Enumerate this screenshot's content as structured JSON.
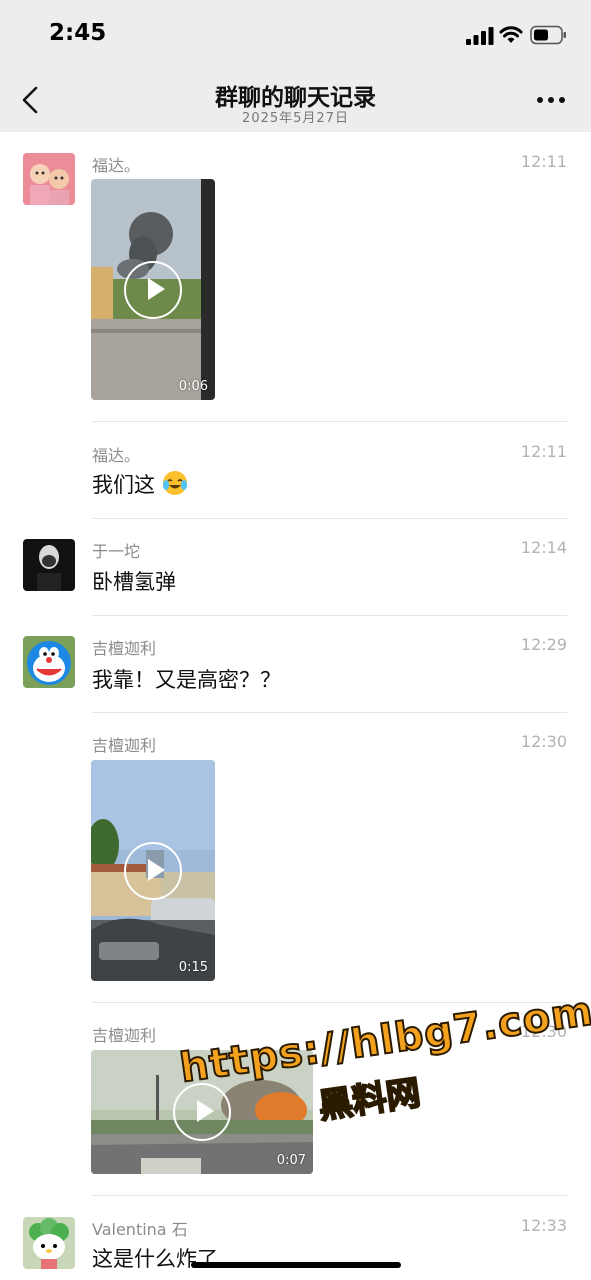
{
  "status_bar": {
    "time": "2:45"
  },
  "nav": {
    "title": "群聊的聊天记录",
    "subtitle": "2025年5月27日"
  },
  "messages": [
    {
      "sender": "福达。",
      "time": "12:11",
      "type": "video",
      "duration": "0:06"
    },
    {
      "sender": "福达。",
      "time": "12:11",
      "type": "text",
      "text": "我们这",
      "emoji": "😭"
    },
    {
      "sender": "于一坨",
      "time": "12:14",
      "type": "text",
      "text": "卧槽氢弹"
    },
    {
      "sender": "吉檀迦利",
      "time": "12:29",
      "type": "text",
      "text": "我靠！又是高密？？"
    },
    {
      "sender": "吉檀迦利",
      "time": "12:30",
      "type": "video",
      "duration": "0:15"
    },
    {
      "sender": "吉檀迦利",
      "time": "12:30",
      "type": "video",
      "duration": "0:07"
    },
    {
      "sender": "Valentina 石",
      "time": "12:33",
      "type": "text",
      "text": "这是什么炸了"
    }
  ],
  "watermark": {
    "line1": "https://hlbg7.com",
    "line2": "黑料网"
  }
}
